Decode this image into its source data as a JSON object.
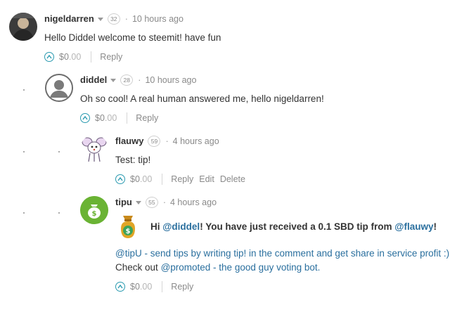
{
  "colors": {
    "vote": "#2a9ab0",
    "link": "#2a6f9e",
    "tipu_green": "#6ab334"
  },
  "comments": [
    {
      "author": "nigeldarren",
      "rep": "32",
      "time": "10 hours ago",
      "text": "Hello Diddel welcome to steemit! have fun",
      "payout_main": "$0",
      "payout_cents": ".00",
      "reply": "Reply"
    },
    {
      "author": "diddel",
      "rep": "28",
      "time": "10 hours ago",
      "text": "Oh so cool! A real human answered me, hello nigeldarren!",
      "payout_main": "$0",
      "payout_cents": ".00",
      "reply": "Reply"
    },
    {
      "author": "flauwy",
      "rep": "59",
      "time": "4 hours ago",
      "text": "Test: tip!",
      "payout_main": "$0",
      "payout_cents": ".00",
      "reply": "Reply",
      "edit": "Edit",
      "delete": "Delete"
    },
    {
      "author": "tipu",
      "rep": "55",
      "time": "4 hours ago",
      "hi": "Hi",
      "mention1": "@diddel",
      "msg1": "! You have just received a 0.1 SBD tip from",
      "mention2": "@flauwy",
      "excl": "!",
      "line2_link": "@tipU - send tips by writing tip! in the comment and get share in service profit :)",
      "line3_pre": "Check out",
      "line3_link": "@promoted - the good guy voting bot.",
      "payout_main": "$0",
      "payout_cents": ".00",
      "reply": "Reply"
    }
  ]
}
